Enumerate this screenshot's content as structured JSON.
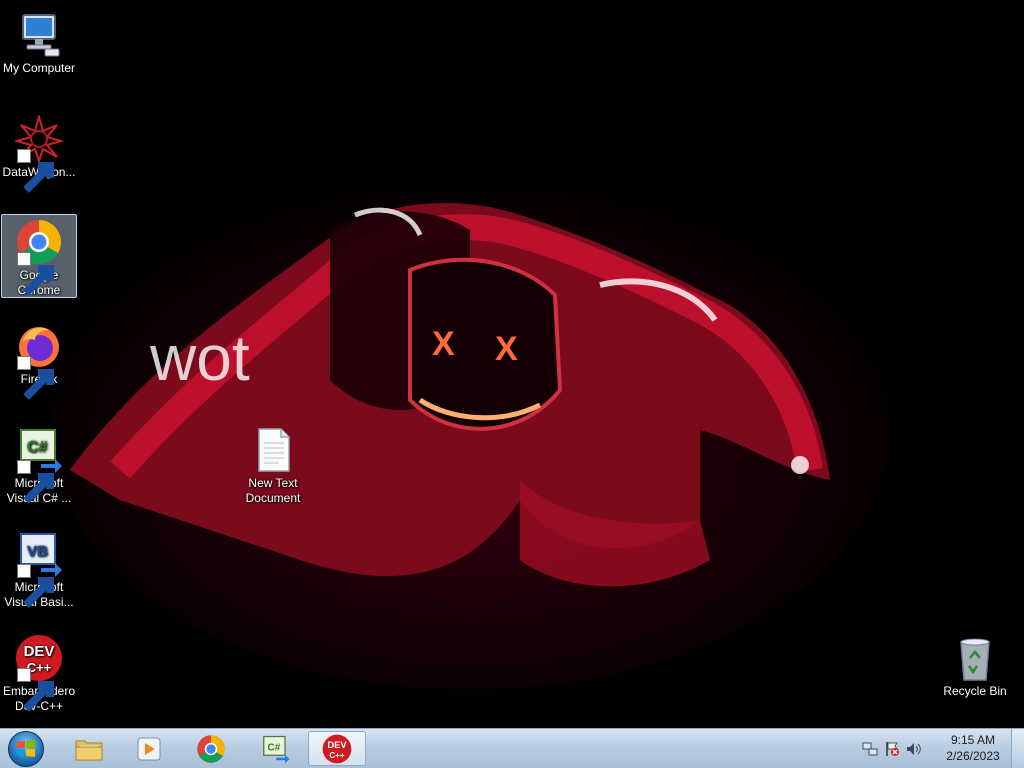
{
  "wallpaper": {
    "overlay_text": "wot"
  },
  "desktop_icons": [
    {
      "id": "my-computer",
      "label": "My Computer"
    },
    {
      "id": "datawagon",
      "label": "DataWagon..."
    },
    {
      "id": "google-chrome",
      "label": "Google Chrome"
    },
    {
      "id": "firefox",
      "label": "Firefox"
    },
    {
      "id": "visual-csharp",
      "label": "Microsoft Visual C# ..."
    },
    {
      "id": "visual-basic",
      "label": "Microsoft Visual Basi..."
    },
    {
      "id": "dev-cpp",
      "label": "Embarcadero Dev-C++"
    },
    {
      "id": "new-text-document",
      "label": "New Text Document"
    },
    {
      "id": "recycle-bin",
      "label": "Recycle Bin"
    }
  ],
  "taskbar": {
    "pinned": [
      {
        "id": "explorer",
        "icon": "folder-icon"
      },
      {
        "id": "media-player",
        "icon": "media-player-icon"
      },
      {
        "id": "chrome",
        "icon": "chrome-icon"
      },
      {
        "id": "visual-csharp",
        "icon": "csharp-icon"
      },
      {
        "id": "dev-cpp",
        "icon": "devcpp-icon"
      }
    ],
    "active": "dev-cpp",
    "icon_text": {
      "devcpp_line1": "DEV",
      "devcpp_line2": "C++",
      "csharp": "C#",
      "vb": "VB"
    }
  },
  "clock": {
    "time": "9:15 AM",
    "date": "2/26/2023"
  },
  "colors": {
    "taskbar_top": "#d7e4f1",
    "taskbar_bottom": "#a9c0d8",
    "hoodie_red": "#c8102e"
  }
}
